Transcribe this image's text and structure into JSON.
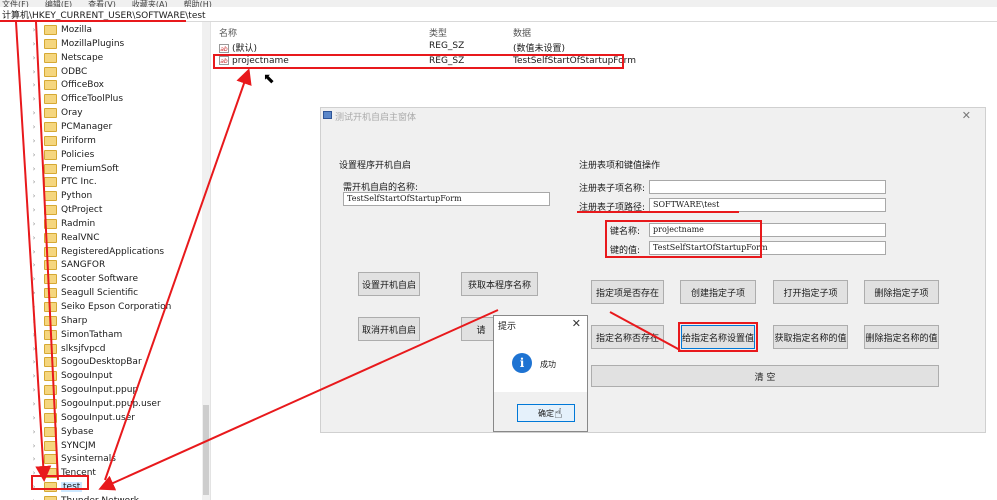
{
  "menu": [
    "文件(F)",
    "编辑(E)",
    "查看(V)",
    "收藏夹(A)",
    "帮助(H)"
  ],
  "address": "计算机\\HKEY_CURRENT_USER\\SOFTWARE\\test",
  "tree_items": [
    {
      "label": "Mozilla"
    },
    {
      "label": "MozillaPlugins"
    },
    {
      "label": "Netscape"
    },
    {
      "label": "ODBC"
    },
    {
      "label": "OfficeBox"
    },
    {
      "label": "OfficeToolPlus"
    },
    {
      "label": "Oray"
    },
    {
      "label": "PCManager"
    },
    {
      "label": "Piriform"
    },
    {
      "label": "Policies"
    },
    {
      "label": "PremiumSoft"
    },
    {
      "label": "PTC Inc."
    },
    {
      "label": "Python"
    },
    {
      "label": "QtProject"
    },
    {
      "label": "Radmin"
    },
    {
      "label": "RealVNC"
    },
    {
      "label": "RegisteredApplications"
    },
    {
      "label": "SANGFOR"
    },
    {
      "label": "Scooter Software"
    },
    {
      "label": "Seagull Scientific"
    },
    {
      "label": "Seiko Epson Corporation"
    },
    {
      "label": "Sharp"
    },
    {
      "label": "SimonTatham"
    },
    {
      "label": "slksjfvpcd"
    },
    {
      "label": "SogouDesktopBar"
    },
    {
      "label": "SogouInput"
    },
    {
      "label": "SogouInput.ppup"
    },
    {
      "label": "SogouInput.ppup.user"
    },
    {
      "label": "SogouInput.user"
    },
    {
      "label": "Sybase"
    },
    {
      "label": "SYNCJM"
    },
    {
      "label": "Sysinternals"
    },
    {
      "label": "Tencent"
    },
    {
      "label": "test",
      "selected": true
    },
    {
      "label": "Thunder Network"
    }
  ],
  "list": {
    "headers": {
      "name": "名称",
      "type": "类型",
      "data": "数据"
    },
    "rows": [
      {
        "name": "(默认)",
        "type": "REG_SZ",
        "data": "(数值未设置)"
      },
      {
        "name": "projectname",
        "type": "REG_SZ",
        "data": "TestSelfStartOfStartupForm"
      }
    ]
  },
  "form": {
    "title": "测试开机自启主窗体",
    "close": "✕",
    "left_section": "设置程序开机自启",
    "name_label": "需开机自启的名称:",
    "name_value": "TestSelfStartOfStartupForm",
    "right_section": "注册表项和键值操作",
    "subkey_name_label": "注册表子项名称:",
    "subkey_name_value": "",
    "subkey_path_label": "注册表子项路径:",
    "subkey_path_value": "SOFTWARE\\test",
    "key_name_label": "键名称:",
    "key_name_value": "projectname",
    "key_value_label": "键的值:",
    "key_value_value": "TestSelfStartOfStartupForm",
    "buttons": {
      "set_autostart": "设置开机自启",
      "get_program_name": "获取本程序名称",
      "cancel_autostart": "取消开机自启",
      "hidden_btn": "请",
      "check_key_exists": "指定项是否存在",
      "create_subkey": "创建指定子项",
      "open_subkey": "打开指定子项",
      "delete_subkey": "删除指定子项",
      "check_name_exists": "指定名称否存在",
      "set_name_value": "给指定名称设置值",
      "get_name_value": "获取指定名称的值",
      "delete_name_value": "删除指定名称的值",
      "clear": "清          空"
    }
  },
  "msgbox": {
    "title": "提示",
    "close": "✕",
    "message": "成功",
    "ok": "确定",
    "icon": "info-icon"
  },
  "colors": {
    "annotation_red": "#e8191c",
    "focus_blue": "#0078d7"
  }
}
